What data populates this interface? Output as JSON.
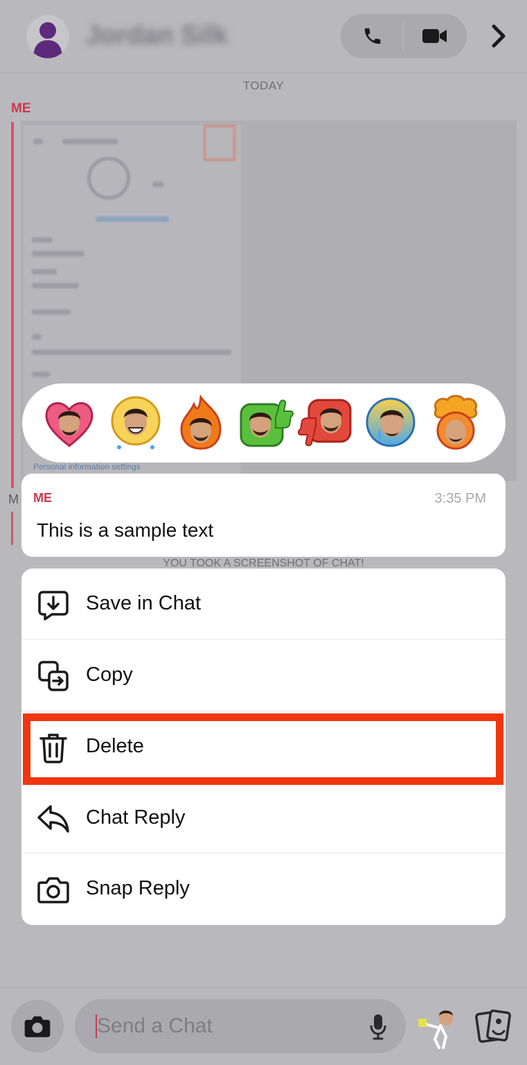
{
  "header": {
    "contact_name": "Jordan Silk",
    "icons": [
      "avatar-silhouette",
      "phone-icon",
      "video-camera-icon",
      "chevron-right-icon"
    ]
  },
  "chat": {
    "date_divider": "TODAY",
    "sender_label": "ME",
    "screenshot_caption": "Personal information settings",
    "second_sender_initial": "M",
    "system_note": "YOU TOOK A SCREENSHOT OF CHAT!"
  },
  "reactions": [
    {
      "name": "heart-bitmoji-reaction"
    },
    {
      "name": "crying-laughing-bitmoji-reaction"
    },
    {
      "name": "fire-bitmoji-reaction"
    },
    {
      "name": "thumbs-up-bitmoji-reaction"
    },
    {
      "name": "thumbs-down-bitmoji-reaction"
    },
    {
      "name": "sad-tear-bitmoji-reaction"
    },
    {
      "name": "mind-blown-bitmoji-reaction"
    }
  ],
  "message": {
    "sender": "ME",
    "time": "3:35 PM",
    "text": "This is a sample text"
  },
  "menu": {
    "items": [
      {
        "label": "Save in Chat",
        "icon": "save-in-chat-icon"
      },
      {
        "label": "Copy",
        "icon": "copy-icon"
      },
      {
        "label": "Delete",
        "icon": "trash-icon",
        "highlighted": true
      },
      {
        "label": "Chat Reply",
        "icon": "reply-arrow-icon"
      },
      {
        "label": "Snap Reply",
        "icon": "camera-icon"
      }
    ],
    "highlight_color": "#f0360f"
  },
  "composer": {
    "placeholder": "Send a Chat",
    "icons": [
      "camera-icon",
      "microphone-icon",
      "bitmoji-icon",
      "cards-icon"
    ]
  },
  "colors": {
    "accent_red": "#c83a4e",
    "overlay_gray": "#b9b9bd",
    "card_white": "#ffffff"
  }
}
